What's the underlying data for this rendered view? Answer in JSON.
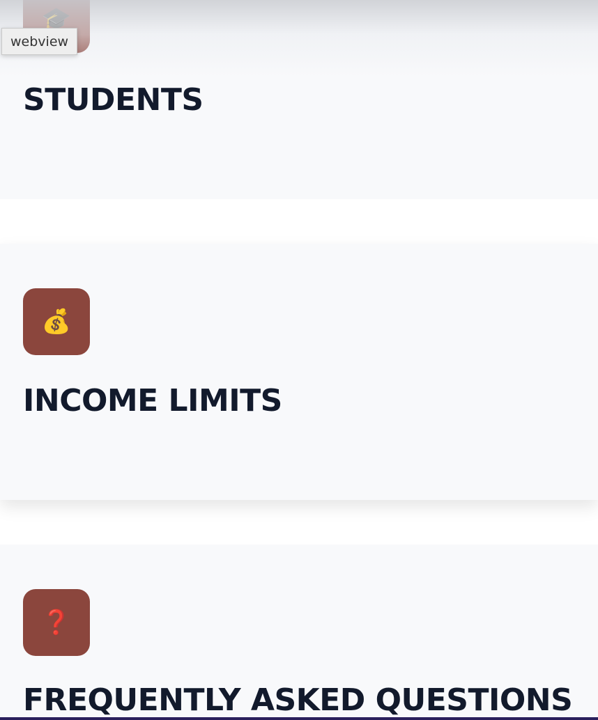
{
  "badge": {
    "label": "webview"
  },
  "cards": [
    {
      "icon": "graduation-cap-icon",
      "glyph": "🎓",
      "title": "STUDENTS"
    },
    {
      "icon": "money-bag-icon",
      "glyph": "💰",
      "title": "INCOME LIMITS"
    },
    {
      "icon": "question-mark-icon",
      "glyph": "❓",
      "title": "FREQUENTLY ASKED QUESTIONS"
    }
  ],
  "colors": {
    "card_background": "#f8f9fb",
    "icon_tile": "#8b463d",
    "title_text": "#121a2c",
    "bottom_bar": "#2a1f5c"
  }
}
